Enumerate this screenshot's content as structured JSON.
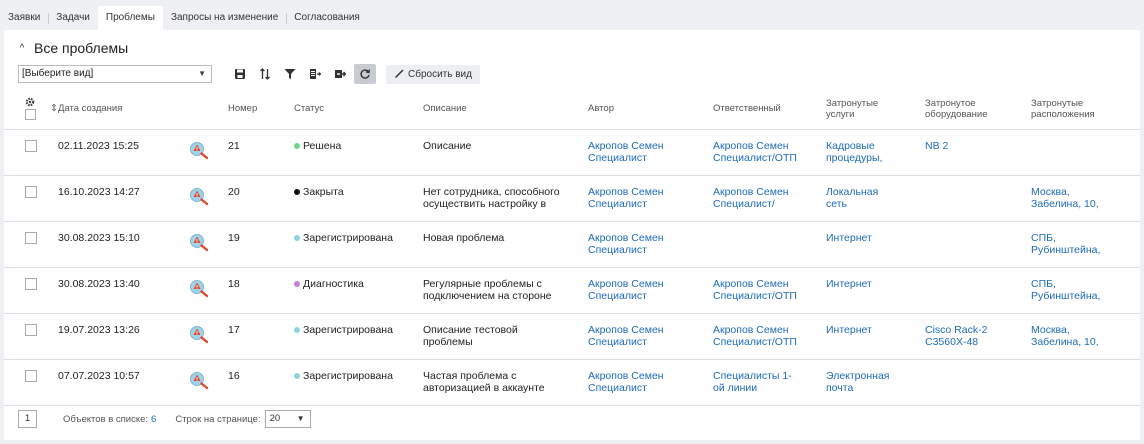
{
  "tabs": [
    {
      "label": "Заявки"
    },
    {
      "label": "Задачи"
    },
    {
      "label": "Проблемы",
      "active": true
    },
    {
      "label": "Запросы на изменение"
    },
    {
      "label": "Согласования"
    }
  ],
  "header": {
    "collapse_glyph": "^",
    "title": "Все проблемы"
  },
  "toolbar": {
    "view_select_value": "[Выберите вид]",
    "caret": "▼",
    "buttons": [
      "save-icon",
      "sort-icon",
      "filter-icon",
      "export-icon",
      "import-icon",
      "refresh-icon"
    ],
    "reset_label": "Сбросить вид"
  },
  "columns": {
    "date": "Дата создания",
    "number": "Номер",
    "status": "Статус",
    "description": "Описание",
    "author": "Автор",
    "responsible": "Ответственный",
    "services": [
      "Затронутые",
      "услуги"
    ],
    "equipment": [
      "Затронутое",
      "оборудование"
    ],
    "locations": [
      "Затронутые",
      "расположения"
    ]
  },
  "status_colors": {
    "Решена": "#6fd68a",
    "Закрыта": "#111111",
    "Зарегистрирована": "#8ed3e0",
    "Диагностика": "#c47fe0"
  },
  "rows": [
    {
      "date": "02.11.2023 15:25",
      "number": "21",
      "status": "Решена",
      "description": [
        "Описание",
        ""
      ],
      "author": [
        "Акропов Семен",
        "Специалист"
      ],
      "responsible": [
        "Акропов Семен",
        "Специалист/ОТП"
      ],
      "services": [
        "Кадровые",
        "процедуры,"
      ],
      "equipment": [
        "NB 2",
        ""
      ],
      "locations": [
        "",
        ""
      ]
    },
    {
      "date": "16.10.2023 14:27",
      "number": "20",
      "status": "Закрыта",
      "description": [
        "Нет сотрудника, способного",
        "осуществить настройку в"
      ],
      "author": [
        "Акропов Семен",
        "Специалист"
      ],
      "responsible": [
        "Акропов Семен",
        "Специалист/"
      ],
      "services": [
        "Локальная",
        "сеть"
      ],
      "equipment": [
        "",
        ""
      ],
      "locations": [
        "Москва,",
        "Забелина, 10,"
      ]
    },
    {
      "date": "30.08.2023 15:10",
      "number": "19",
      "status": "Зарегистрирована",
      "description": [
        "Новая проблема",
        ""
      ],
      "author": [
        "Акропов Семен",
        "Специалист"
      ],
      "responsible": [
        "",
        ""
      ],
      "services": [
        "Интернет",
        ""
      ],
      "equipment": [
        "",
        ""
      ],
      "locations": [
        "СПБ,",
        "Рубинштейна,"
      ]
    },
    {
      "date": "30.08.2023 13:40",
      "number": "18",
      "status": "Диагностика",
      "description": [
        "Регулярные проблемы с",
        "подключением на стороне"
      ],
      "author": [
        "Акропов Семен",
        "Специалист"
      ],
      "responsible": [
        "Акропов Семен",
        "Специалист/ОТП"
      ],
      "services": [
        "Интернет",
        ""
      ],
      "equipment": [
        "",
        ""
      ],
      "locations": [
        "СПБ,",
        "Рубинштейна,"
      ]
    },
    {
      "date": "19.07.2023 13:26",
      "number": "17",
      "status": "Зарегистрирована",
      "description": [
        "Описание тестовой",
        "проблемы"
      ],
      "author": [
        "Акропов Семен",
        "Специалист"
      ],
      "responsible": [
        "Акропов Семен",
        "Специалист/ОТП"
      ],
      "services": [
        "Интернет",
        ""
      ],
      "equipment": [
        "Cisco Rack-2",
        "C3560X-48"
      ],
      "locations": [
        "Москва,",
        "Забелина, 10,"
      ]
    },
    {
      "date": "07.07.2023 10:57",
      "number": "16",
      "status": "Зарегистрирована",
      "description": [
        "Частая проблема с",
        "авторизацией в аккаунте"
      ],
      "author": [
        "Акропов Семен",
        "Специалист"
      ],
      "responsible": [
        "Специалисты 1-",
        "ой линии"
      ],
      "services": [
        "Электронная",
        "почта"
      ],
      "equipment": [
        "",
        ""
      ],
      "locations": [
        "",
        ""
      ]
    }
  ],
  "footer": {
    "page": "1",
    "count_label": "Объектов в списке:",
    "count_value": "6",
    "rows_label": "Строк на странице:",
    "rows_value": "20"
  }
}
